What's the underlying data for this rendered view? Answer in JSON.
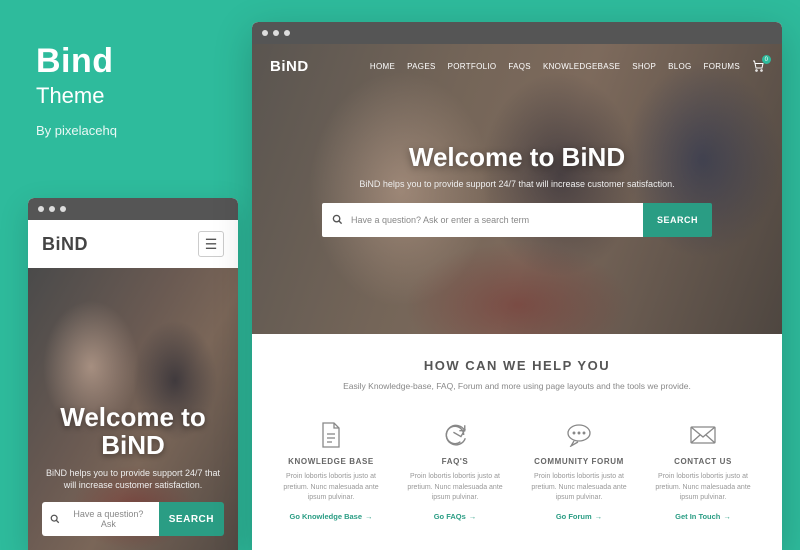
{
  "title": {
    "name": "Bind",
    "sub": "Theme",
    "by": "By pixelacehq"
  },
  "brand": "BiND",
  "nav": {
    "items": [
      "HOME",
      "PAGES",
      "PORTFOLIO",
      "FAQS",
      "KNOWLEDGEBASE",
      "SHOP",
      "BLOG",
      "FORUMS"
    ],
    "cart_badge": "0"
  },
  "hero": {
    "title": "Welcome to BiND",
    "tagline": "BiND helps you to provide support 24/7 that will increase customer satisfaction.",
    "search_placeholder": "Have a question? Ask or enter a search term",
    "search_placeholder_short": "Have a question? Ask",
    "search_button": "SEARCH"
  },
  "help": {
    "heading": "HOW CAN WE HELP YOU",
    "desc": "Easily Knowledge-base, FAQ, Forum and more using page layouts and the tools we provide.",
    "body": "Proin lobortis lobortis justo at pretium. Nunc malesuada ante ipsum pulvinar.",
    "cards": [
      {
        "title": "KNOWLEDGE BASE",
        "cta": "Go Knowledge Base"
      },
      {
        "title": "FAQ'S",
        "cta": "Go FAQs"
      },
      {
        "title": "COMMUNITY FORUM",
        "cta": "Go Forum"
      },
      {
        "title": "CONTACT US",
        "cta": "Get In Touch"
      }
    ]
  }
}
